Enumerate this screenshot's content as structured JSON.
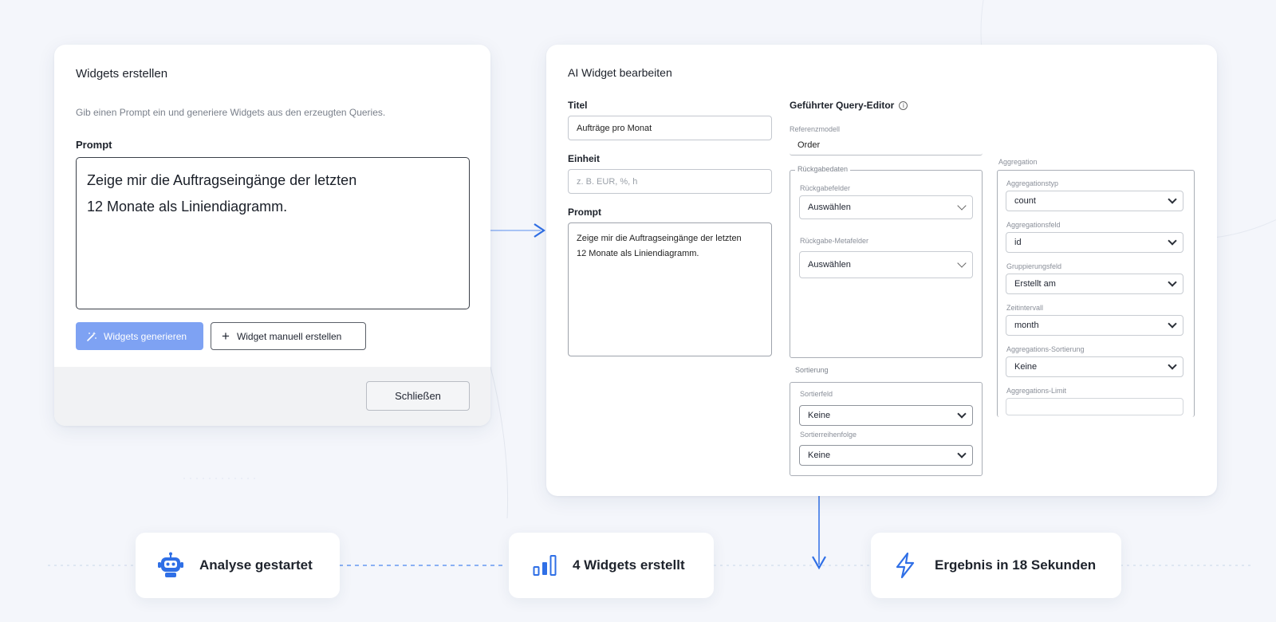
{
  "left_modal": {
    "title": "Widgets erstellen",
    "description": "Gib einen Prompt ein und generiere Widgets aus den erzeugten Queries.",
    "prompt_label": "Prompt",
    "prompt_value": "Zeige mir die Auftragseingänge der letzten\n12 Monate als Liniendiagramm.",
    "generate_button": "Widgets generieren",
    "manual_button": "Widget manuell erstellen",
    "close_button": "Schließen"
  },
  "right_card": {
    "title": "AI Widget bearbeiten",
    "titel_label": "Titel",
    "titel_value": "Aufträge pro Monat",
    "einheit_label": "Einheit",
    "einheit_placeholder": "z. B. EUR, %, h",
    "prompt_label": "Prompt",
    "prompt_value": "Zeige mir die Auftragseingänge der letzten\n12 Monate als Liniendiagramm.",
    "query_editor_label": "Geführter Query-Editor",
    "reference_model_label": "Referenzmodell",
    "reference_model_value": "Order",
    "return_data": {
      "legend": "Rückgabedaten",
      "fields_label": "Rückgabefelder",
      "fields_value": "Auswählen",
      "meta_label": "Rückgabe-Metafelder",
      "meta_value": "Auswählen"
    },
    "sorting": {
      "legend": "Sortierung",
      "field_label": "Sortierfeld",
      "field_value": "Keine",
      "order_label": "Sortierreihenfolge",
      "order_value": "Keine"
    },
    "aggregation": {
      "legend": "Aggregation",
      "type_label": "Aggregationstyp",
      "type_value": "count",
      "field_label": "Aggregationsfeld",
      "field_value": "id",
      "group_label": "Gruppierungsfeld",
      "group_value": "Erstellt am",
      "interval_label": "Zeitintervall",
      "interval_value": "month",
      "sort_label": "Aggregations-Sortierung",
      "sort_value": "Keine",
      "limit_label": "Aggregations-Limit",
      "limit_value": ""
    }
  },
  "status_pills": [
    {
      "text": "Analyse gestartet",
      "icon": "robot-icon"
    },
    {
      "text": "4 Widgets erstellt",
      "icon": "bar-chart-icon"
    },
    {
      "text": "Ergebnis in 18 Sekunden",
      "icon": "lightning-icon"
    }
  ],
  "colors": {
    "accent": "#2f6fe6",
    "generate_button": "#7ea2f3",
    "background": "#f4f6fb"
  }
}
